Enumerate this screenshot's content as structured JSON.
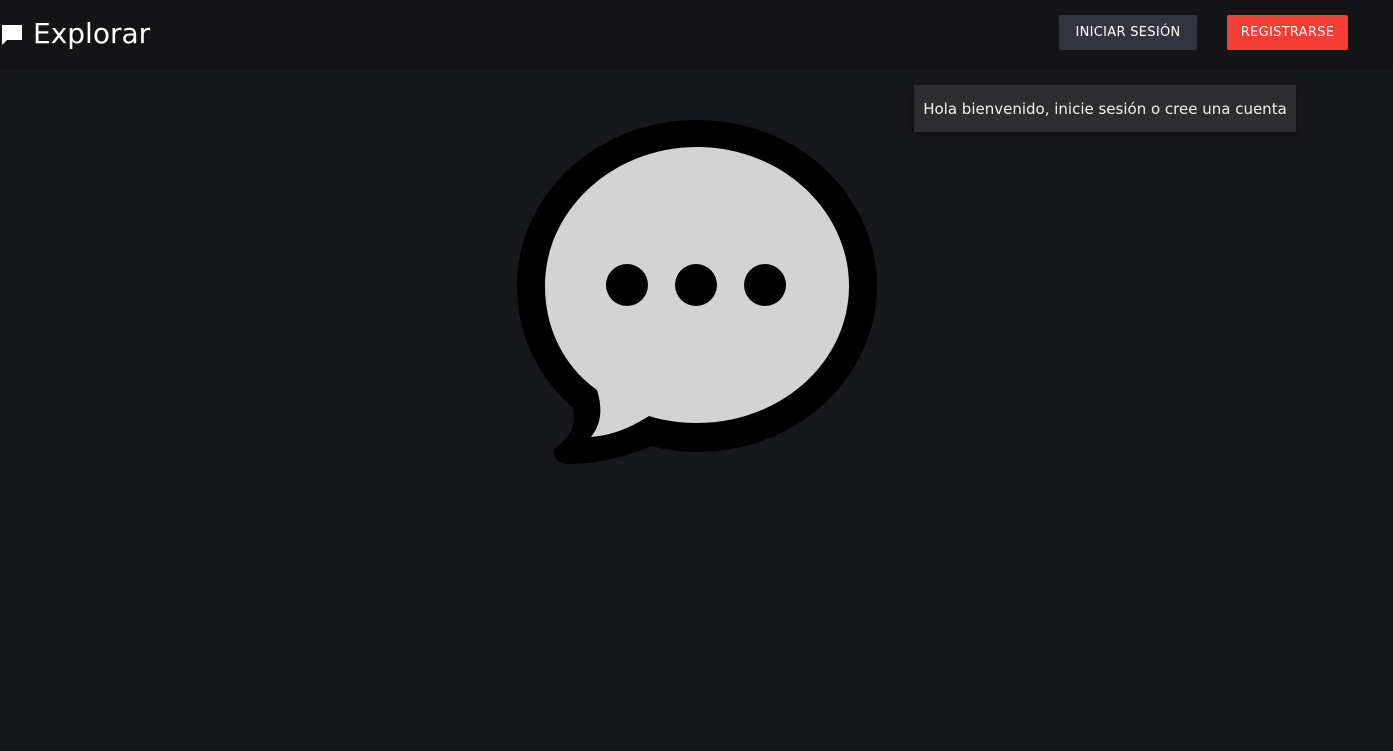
{
  "header": {
    "brand_icon": "chat-bubble-icon",
    "title": "Explorar",
    "login_label": "INICIAR SESIÓN",
    "register_label": "REGISTRARSE"
  },
  "toast": {
    "message": "Hola bienvenido, inicie sesión o cree una cuenta"
  },
  "hero": {
    "icon": "chat-typing-icon"
  },
  "colors": {
    "background": "#16171b",
    "header": "#141416",
    "login_button": "#303540",
    "register_button": "#f23d34",
    "toast_background": "#2d2d2f",
    "bubble_fill": "#d3d3d3"
  }
}
